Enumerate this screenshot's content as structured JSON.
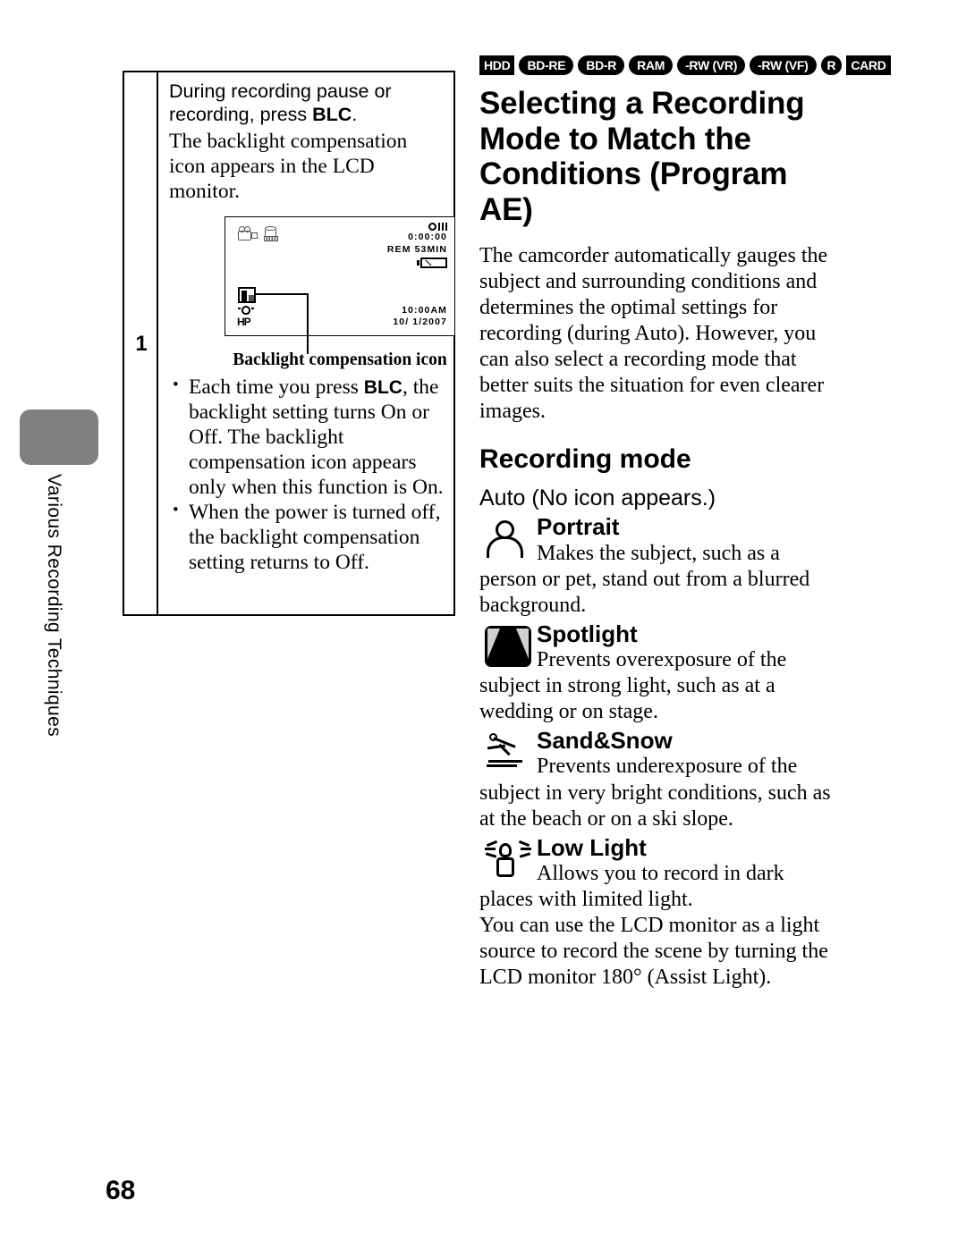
{
  "sidebar": {
    "section_label": "Various Recording Techniques",
    "tab_color": "#808080"
  },
  "step_box": {
    "step_number": "1",
    "instruction_lead": "During recording pause or recording, press ",
    "instruction_lead_bold": "BLC",
    "instruction_lead_tail": ".",
    "instruction_detail": "The backlight compensation icon appears in the LCD monitor.",
    "lcd": {
      "camcorder_icon": "camcorder-icon",
      "media_icon": "hdd-icon",
      "record_indicator": "record-indicator",
      "timecode": "0:00:00",
      "remaining": "REM 53MIN",
      "battery_icon": "battery-icon",
      "backlight_icon": "backlight-compensation-icon",
      "stabilizer_icon": "image-stabilizer-icon",
      "quality_mark": "HP",
      "time": "10:00AM",
      "date": "10/ 1/2007"
    },
    "caption": "Backlight compensation icon",
    "bullets": [
      {
        "pre": "Each time you press ",
        "bold": "BLC",
        "post": ", the backlight setting turns On or Off. The backlight compensation icon appears only when this function is On."
      },
      {
        "pre": "When the power is turned off, the backlight compensation setting returns to Off.",
        "bold": "",
        "post": ""
      }
    ]
  },
  "right": {
    "badges": [
      {
        "label": "HDD",
        "shape": "rect"
      },
      {
        "label": "BD-RE",
        "shape": "pill"
      },
      {
        "label": "BD-R",
        "shape": "pill"
      },
      {
        "label": "RAM",
        "shape": "pill"
      },
      {
        "label": "-RW (VR)",
        "shape": "pill"
      },
      {
        "label": "-RW (VF)",
        "shape": "pill"
      },
      {
        "label": "R",
        "shape": "round"
      },
      {
        "label": "CARD",
        "shape": "rect"
      }
    ],
    "title": "Selecting a Recording Mode to Match the Conditions (Program AE)",
    "intro": "The camcorder automatically gauges the subject and surrounding conditions and determines the optimal settings for recording (during Auto). However, you can also select a recording mode that better suits the situation for even clearer images.",
    "section_heading": "Recording mode",
    "auto_label": "Auto (No icon appears.)",
    "modes": [
      {
        "icon": "portrait-icon",
        "name": "Portrait",
        "desc": "Makes the subject, such as a person or pet, stand out from a blurred background."
      },
      {
        "icon": "spotlight-icon",
        "name": "Spotlight",
        "desc": "Prevents overexposure of the subject in strong light, such as at a wedding or on stage."
      },
      {
        "icon": "sand-snow-icon",
        "name": "Sand&Snow",
        "desc": "Prevents underexposure of the subject in very bright conditions, such as at the beach or on a ski slope."
      },
      {
        "icon": "low-light-icon",
        "name": "Low Light",
        "desc": "Allows you to record in dark places with limited light."
      }
    ],
    "closing": "You can use the LCD monitor as a light source to record the scene by turning the LCD monitor 180° (Assist Light)."
  },
  "page_number": "68"
}
